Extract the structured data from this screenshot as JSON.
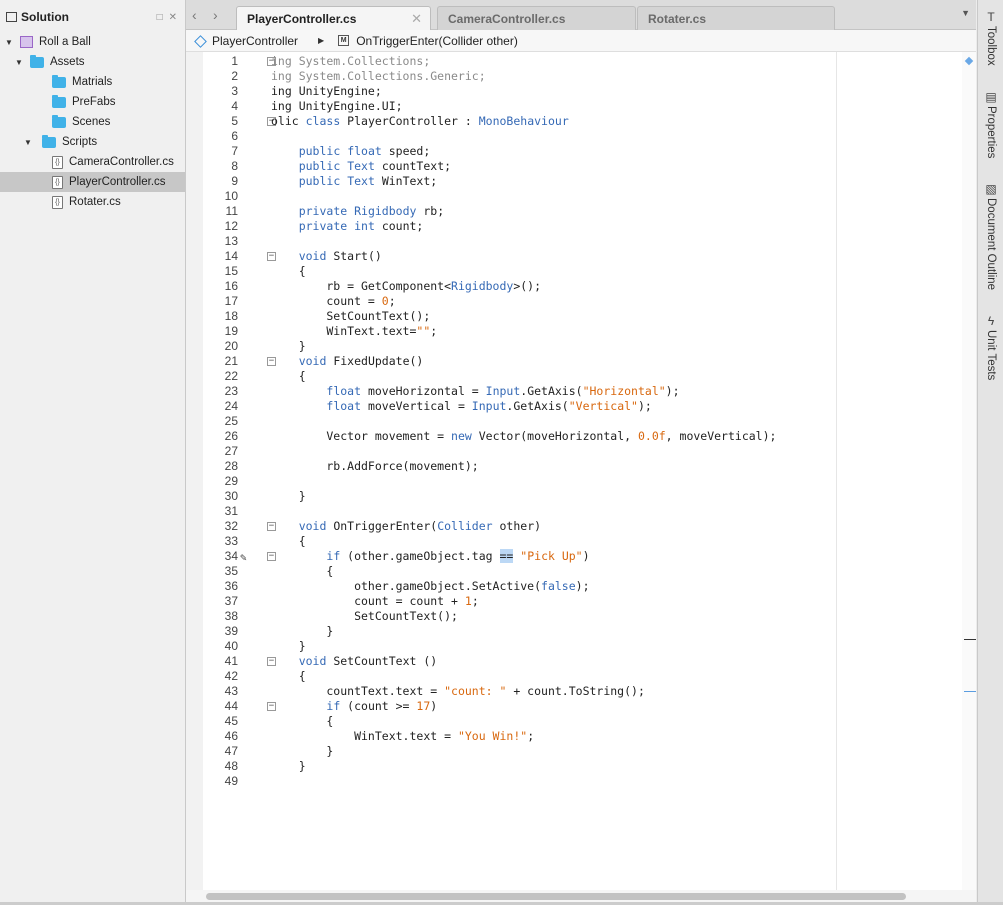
{
  "solution": {
    "title": "Solution",
    "tree": [
      {
        "label": "Roll a Ball",
        "type": "solution",
        "indent": 0
      },
      {
        "label": "Assets",
        "type": "folder",
        "indent": 1
      },
      {
        "label": "Matrials",
        "type": "folder",
        "indent": 2
      },
      {
        "label": "PreFabs",
        "type": "folder",
        "indent": 2
      },
      {
        "label": "Scenes",
        "type": "folder",
        "indent": 2
      },
      {
        "label": "Scripts",
        "type": "folder",
        "indent": 2
      },
      {
        "label": "CameraController.cs",
        "type": "file",
        "indent": 3
      },
      {
        "label": "PlayerController.cs",
        "type": "file",
        "indent": 3,
        "selected": true
      },
      {
        "label": "Rotater.cs",
        "type": "file",
        "indent": 3
      }
    ]
  },
  "tabs": [
    {
      "label": "PlayerController.cs",
      "active": true
    },
    {
      "label": "CameraController.cs",
      "active": false
    },
    {
      "label": "Rotater.cs",
      "active": false
    }
  ],
  "breadcrumb": {
    "class_name": "PlayerController",
    "method_name": "OnTriggerEnter(Collider other)"
  },
  "side_panels": [
    "Toolbox",
    "Properties",
    "Document Outline",
    "Unit Tests"
  ],
  "code_lines": [
    {
      "n": "1",
      "t": "ing System.Collections;",
      "dim": true,
      "fold": true
    },
    {
      "n": "2",
      "t": "ing System.Collections.Generic;",
      "dim": true
    },
    {
      "n": "3",
      "t": "ing UnityEngine;"
    },
    {
      "n": "4",
      "t": "ing UnityEngine.UI;"
    },
    {
      "n": "5",
      "t": "olic class PlayerController : MonoBehaviour",
      "fold": true
    },
    {
      "n": "6",
      "t": ""
    },
    {
      "n": "7",
      "t": "    public float speed;"
    },
    {
      "n": "8",
      "t": "    public Text countText;"
    },
    {
      "n": "9",
      "t": "    public Text WinText;"
    },
    {
      "n": "10",
      "t": ""
    },
    {
      "n": "11",
      "t": "    private Rigidbody rb;"
    },
    {
      "n": "12",
      "t": "    private int count;"
    },
    {
      "n": "13",
      "t": ""
    },
    {
      "n": "14",
      "t": "    void Start()",
      "fold": true
    },
    {
      "n": "15",
      "t": "    {"
    },
    {
      "n": "16",
      "t": "        rb = GetComponent<Rigidbody>();"
    },
    {
      "n": "17",
      "t": "        count = 0;"
    },
    {
      "n": "18",
      "t": "        SetCountText();"
    },
    {
      "n": "19",
      "t": "        WinText.text=\"\";"
    },
    {
      "n": "20",
      "t": "    }"
    },
    {
      "n": "21",
      "t": "    void FixedUpdate()",
      "fold": true
    },
    {
      "n": "22",
      "t": "    {"
    },
    {
      "n": "23",
      "t": "        float moveHorizontal = Input.GetAxis(\"Horizontal\");"
    },
    {
      "n": "24",
      "t": "        float moveVertical = Input.GetAxis(\"Vertical\");"
    },
    {
      "n": "25",
      "t": ""
    },
    {
      "n": "26",
      "t": "        Vector3 movement = new Vector3(moveHorizontal, 0.0f, moveVertical);"
    },
    {
      "n": "27",
      "t": ""
    },
    {
      "n": "28",
      "t": "        rb.AddForce(movement);"
    },
    {
      "n": "29",
      "t": ""
    },
    {
      "n": "30",
      "t": "    }"
    },
    {
      "n": "31",
      "t": ""
    },
    {
      "n": "32",
      "t": "    void OnTriggerEnter(Collider other)",
      "fold": true
    },
    {
      "n": "33",
      "t": "    {"
    },
    {
      "n": "34",
      "t": "        if (other.gameObject.tag == \"Pick Up\")",
      "fold": true
    },
    {
      "n": "35",
      "t": "        {"
    },
    {
      "n": "36",
      "t": "            other.gameObject.SetActive(false);"
    },
    {
      "n": "37",
      "t": "            count = count + 1;"
    },
    {
      "n": "38",
      "t": "            SetCountText();"
    },
    {
      "n": "39",
      "t": "        }"
    },
    {
      "n": "40",
      "t": "    }"
    },
    {
      "n": "41",
      "t": "    void SetCountText ()",
      "fold": true
    },
    {
      "n": "42",
      "t": "    {"
    },
    {
      "n": "43",
      "t": "        countText.text = \"count: \" + count.ToString();"
    },
    {
      "n": "44",
      "t": "        if (count >= 17)",
      "fold": true
    },
    {
      "n": "45",
      "t": "        {"
    },
    {
      "n": "46",
      "t": "            WinText.text = \"You Win!\";"
    },
    {
      "n": "47",
      "t": "        }"
    },
    {
      "n": "48",
      "t": "    }"
    },
    {
      "n": "49",
      "t": ""
    }
  ],
  "colors": {
    "keyword": "#3569b5",
    "string": "#d8680f",
    "folder": "#40b2e8"
  },
  "icons": [
    "solution-icon",
    "folder-icon",
    "csharp-file-icon",
    "back-icon",
    "forward-icon",
    "close-icon",
    "lightbulb-icon"
  ]
}
